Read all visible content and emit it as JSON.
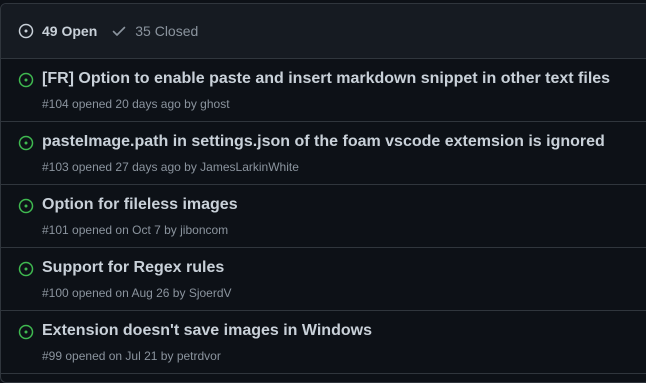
{
  "header": {
    "open_label": "49 Open",
    "closed_label": "35 Closed",
    "open_icon": "issue-opened-icon",
    "closed_icon": "check-icon"
  },
  "colors": {
    "open_green": "#3fb950",
    "text": "#c9d1d9",
    "muted": "#8b949e",
    "border": "#30363d"
  },
  "issues": [
    {
      "title": "[FR] Option to enable paste and insert markdown snippet in other text files",
      "number": "#104",
      "opened": "opened 20 days ago by",
      "author": "ghost"
    },
    {
      "title": "pasteImage.path in settings.json of the foam vscode extemsion is ignored",
      "number": "#103",
      "opened": "opened 27 days ago by",
      "author": "JamesLarkinWhite"
    },
    {
      "title": "Option for fileless images",
      "number": "#101",
      "opened": "opened on Oct 7 by",
      "author": "jiboncom"
    },
    {
      "title": "Support for Regex rules",
      "number": "#100",
      "opened": "opened on Aug 26 by",
      "author": "SjoerdV"
    },
    {
      "title": "Extension doesn't save images in Windows",
      "number": "#99",
      "opened": "opened on Jul 21 by",
      "author": "petrdvor"
    }
  ]
}
